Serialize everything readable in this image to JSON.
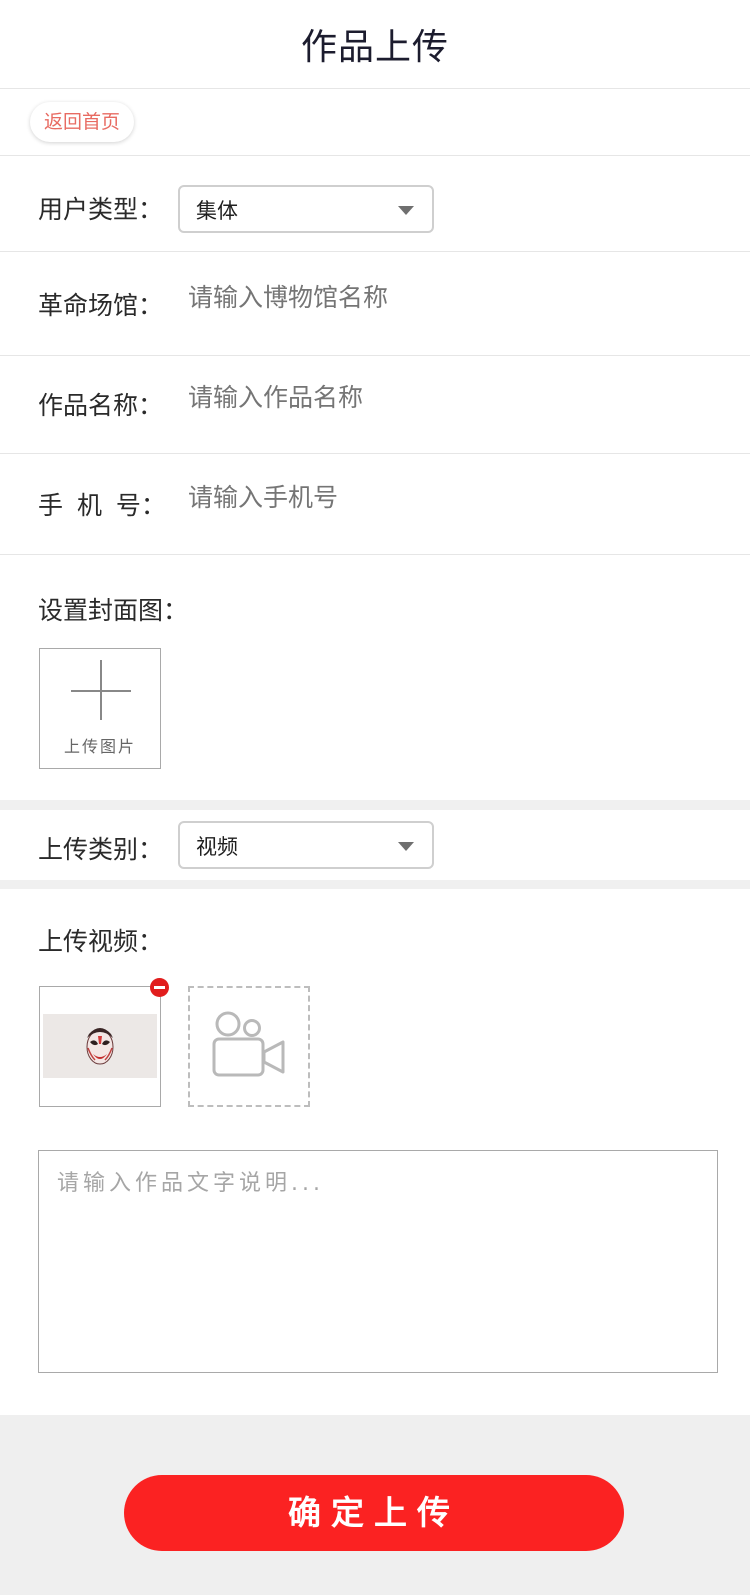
{
  "header": {
    "title": "作品上传"
  },
  "back_button": {
    "label": "返回首页"
  },
  "form": {
    "user_type": {
      "label": "用户类型：",
      "selected": "集体"
    },
    "venue": {
      "label": "革命场馆：",
      "placeholder": "请输入博物馆名称"
    },
    "work_name": {
      "label": "作品名称：",
      "placeholder": "请输入作品名称"
    },
    "phone": {
      "label": "手 机 号：",
      "placeholder": "请输入手机号"
    },
    "cover": {
      "label": "设置封面图：",
      "upload_caption": "上传图片"
    },
    "upload_category": {
      "label": "上传类别：",
      "selected": "视频"
    },
    "video": {
      "label": "上传视频："
    },
    "description": {
      "placeholder": "请输入作品文字说明..."
    }
  },
  "submit": {
    "label": "确定上传"
  },
  "colors": {
    "accent": "#fb2222",
    "back_text": "#e86b62",
    "remove_badge": "#e11d1d"
  },
  "icons": [
    "plus-icon",
    "video-camera-icon",
    "remove-icon",
    "caret-down-icon",
    "opera-mask-thumbnail"
  ]
}
